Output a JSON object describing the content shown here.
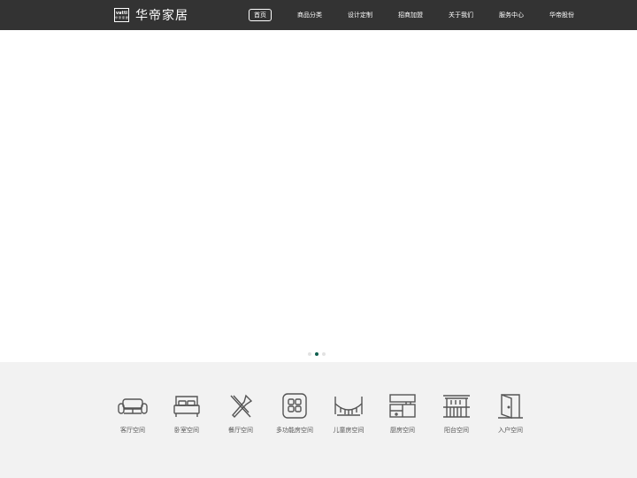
{
  "header": {
    "logo_mark": "vatti",
    "logo_mark_sub": "华 帝 家 居",
    "brand": "华帝家居",
    "nav": [
      {
        "label": "首页",
        "active": true
      },
      {
        "label": "商品分类"
      },
      {
        "label": "设计定制"
      },
      {
        "label": "招商加盟"
      },
      {
        "label": "关于我们"
      },
      {
        "label": "服务中心"
      },
      {
        "label": "华帝股份"
      }
    ]
  },
  "carousel": {
    "slide_count": 3,
    "active_index": 1
  },
  "spaces": [
    {
      "label": "客厅空间",
      "icon": "sofa-icon"
    },
    {
      "label": "卧室空间",
      "icon": "bed-icon"
    },
    {
      "label": "餐厅空间",
      "icon": "fork-knife-icon"
    },
    {
      "label": "多功能房空间",
      "icon": "grid-icon"
    },
    {
      "label": "儿童房空间",
      "icon": "crib-icon"
    },
    {
      "label": "厨房空间",
      "icon": "kitchen-icon"
    },
    {
      "label": "阳台空间",
      "icon": "balcony-icon"
    },
    {
      "label": "入户空间",
      "icon": "door-icon"
    }
  ],
  "colors": {
    "header_bg": "#333333",
    "spaces_bg": "#f2f2f2",
    "dot_active": "#0f5f4e",
    "dot_inactive": "#e2e2e2"
  }
}
